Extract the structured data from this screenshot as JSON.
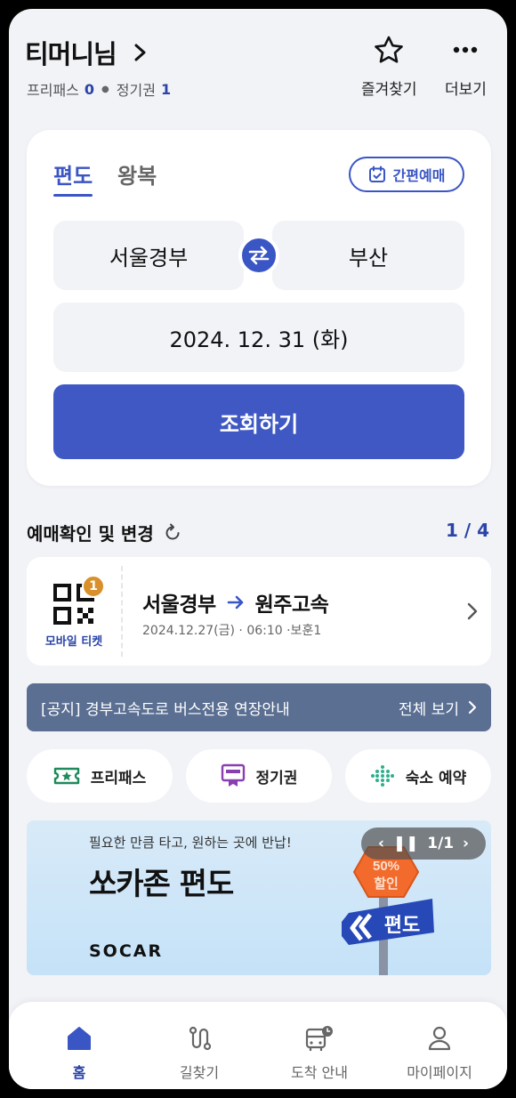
{
  "header": {
    "user_name": "티머니님",
    "freepass_label": "프리패스",
    "freepass_count": "0",
    "season_label": "정기권",
    "season_count": "1",
    "favorites_label": "즐겨찾기",
    "more_label": "더보기"
  },
  "booking": {
    "tab_oneway": "편도",
    "tab_roundtrip": "왕복",
    "quick_booking_label": "간편예매",
    "origin": "서울경부",
    "destination": "부산",
    "date": "2024. 12. 31 (화)",
    "search_label": "조회하기",
    "accent_color": "#3f58c4"
  },
  "reservations": {
    "title": "예매확인 및 변경",
    "page": "1 / 4",
    "ticket": {
      "badge_count": "1",
      "stub_label": "모바일 티켓",
      "from": "서울경부",
      "to": "원주고속",
      "info": "2024.12.27(금) · 06:10 ·보훈1"
    }
  },
  "notice": {
    "text": "[공지] 경부고속도로 버스전용 연장안내",
    "view_all": "전체 보기"
  },
  "quick_menu": [
    {
      "label": "프리패스",
      "icon": "freepass-ticket-icon"
    },
    {
      "label": "정기권",
      "icon": "season-pass-icon"
    },
    {
      "label": "숙소 예약",
      "icon": "lodging-icon"
    }
  ],
  "banner": {
    "subtitle": "필요한 만큼 타고, 원하는 곳에 반납!",
    "title": "쏘카존 편도",
    "brand": "SOCAR",
    "pager": "1/1",
    "sign_discount": "50%",
    "sign_discount_word": "할인",
    "sign_oneway": "편도"
  },
  "bottom_nav": [
    {
      "label": "홈",
      "icon": "home-icon",
      "active": true
    },
    {
      "label": "길찾기",
      "icon": "route-icon"
    },
    {
      "label": "도착 안내",
      "icon": "bus-arrival-icon"
    },
    {
      "label": "마이페이지",
      "icon": "person-icon"
    }
  ]
}
